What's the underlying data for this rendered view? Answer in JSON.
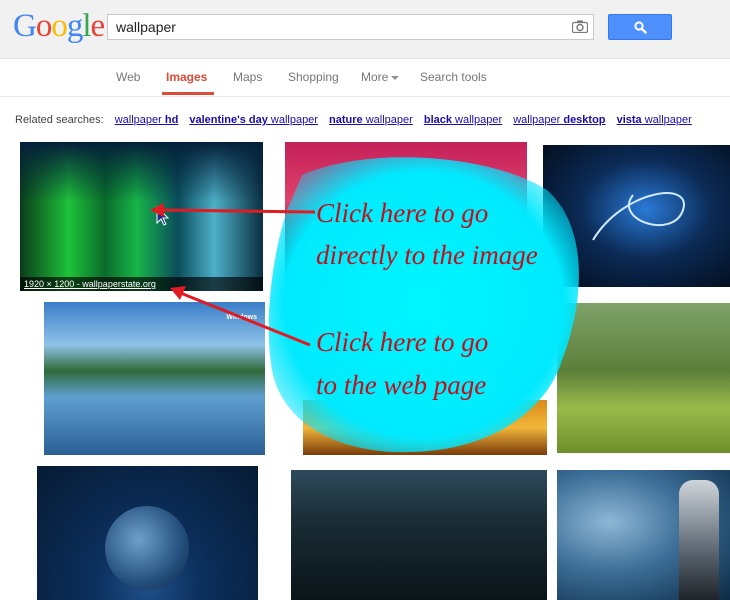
{
  "logo": {
    "letters": [
      "G",
      "o",
      "o",
      "g",
      "l",
      "e"
    ],
    "colors": [
      "#4285f4",
      "#ea4335",
      "#fbbc05",
      "#4285f4",
      "#34a853",
      "#ea4335"
    ]
  },
  "search": {
    "value": "wallpaper"
  },
  "icons": {
    "camera": "camera-icon",
    "search": "search-icon",
    "cursor": "cursor-icon"
  },
  "nav": {
    "tabs": [
      "Web",
      "Images",
      "Maps",
      "Shopping",
      "More",
      "Search tools"
    ],
    "active": "Images"
  },
  "related": {
    "label": "Related searches:",
    "items": [
      {
        "pre": "wallpaper ",
        "bold": "hd",
        "post": ""
      },
      {
        "pre": "",
        "bold": "valentine's day",
        "post": " wallpaper"
      },
      {
        "pre": "",
        "bold": "nature",
        "post": " wallpaper"
      },
      {
        "pre": "",
        "bold": "black",
        "post": " wallpaper"
      },
      {
        "pre": "wallpaper ",
        "bold": "desktop",
        "post": ""
      },
      {
        "pre": "",
        "bold": "vista",
        "post": " wallpaper"
      }
    ]
  },
  "results": {
    "first_caption": "1920 × 1200 - wallpaperstate.org",
    "second_badge": "Windows"
  },
  "callout": {
    "text1_line1": "Click here to go",
    "text1_line2": "directly to the image",
    "text2_line1": "Click here to go",
    "text2_line2": "to the web page"
  },
  "colors": {
    "accent": "#dd4b39",
    "link": "#1a0dab",
    "annotation": "#c0101a",
    "highlight": "#00f0ff",
    "button": "#4d90fe"
  }
}
